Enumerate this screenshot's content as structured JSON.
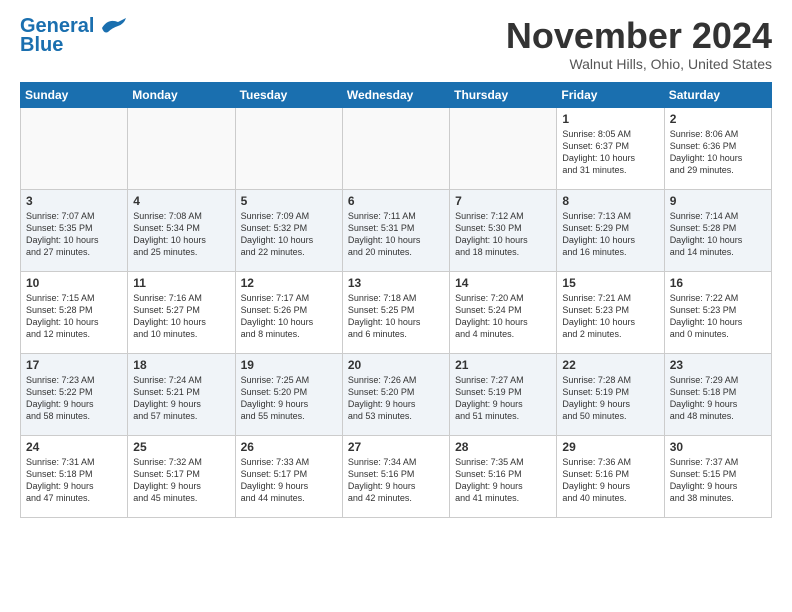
{
  "header": {
    "logo_line1": "General",
    "logo_line2": "Blue",
    "month": "November 2024",
    "location": "Walnut Hills, Ohio, United States"
  },
  "weekdays": [
    "Sunday",
    "Monday",
    "Tuesday",
    "Wednesday",
    "Thursday",
    "Friday",
    "Saturday"
  ],
  "weeks": [
    [
      {
        "day": "",
        "info": ""
      },
      {
        "day": "",
        "info": ""
      },
      {
        "day": "",
        "info": ""
      },
      {
        "day": "",
        "info": ""
      },
      {
        "day": "",
        "info": ""
      },
      {
        "day": "1",
        "info": "Sunrise: 8:05 AM\nSunset: 6:37 PM\nDaylight: 10 hours\nand 31 minutes."
      },
      {
        "day": "2",
        "info": "Sunrise: 8:06 AM\nSunset: 6:36 PM\nDaylight: 10 hours\nand 29 minutes."
      }
    ],
    [
      {
        "day": "3",
        "info": "Sunrise: 7:07 AM\nSunset: 5:35 PM\nDaylight: 10 hours\nand 27 minutes."
      },
      {
        "day": "4",
        "info": "Sunrise: 7:08 AM\nSunset: 5:34 PM\nDaylight: 10 hours\nand 25 minutes."
      },
      {
        "day": "5",
        "info": "Sunrise: 7:09 AM\nSunset: 5:32 PM\nDaylight: 10 hours\nand 22 minutes."
      },
      {
        "day": "6",
        "info": "Sunrise: 7:11 AM\nSunset: 5:31 PM\nDaylight: 10 hours\nand 20 minutes."
      },
      {
        "day": "7",
        "info": "Sunrise: 7:12 AM\nSunset: 5:30 PM\nDaylight: 10 hours\nand 18 minutes."
      },
      {
        "day": "8",
        "info": "Sunrise: 7:13 AM\nSunset: 5:29 PM\nDaylight: 10 hours\nand 16 minutes."
      },
      {
        "day": "9",
        "info": "Sunrise: 7:14 AM\nSunset: 5:28 PM\nDaylight: 10 hours\nand 14 minutes."
      }
    ],
    [
      {
        "day": "10",
        "info": "Sunrise: 7:15 AM\nSunset: 5:28 PM\nDaylight: 10 hours\nand 12 minutes."
      },
      {
        "day": "11",
        "info": "Sunrise: 7:16 AM\nSunset: 5:27 PM\nDaylight: 10 hours\nand 10 minutes."
      },
      {
        "day": "12",
        "info": "Sunrise: 7:17 AM\nSunset: 5:26 PM\nDaylight: 10 hours\nand 8 minutes."
      },
      {
        "day": "13",
        "info": "Sunrise: 7:18 AM\nSunset: 5:25 PM\nDaylight: 10 hours\nand 6 minutes."
      },
      {
        "day": "14",
        "info": "Sunrise: 7:20 AM\nSunset: 5:24 PM\nDaylight: 10 hours\nand 4 minutes."
      },
      {
        "day": "15",
        "info": "Sunrise: 7:21 AM\nSunset: 5:23 PM\nDaylight: 10 hours\nand 2 minutes."
      },
      {
        "day": "16",
        "info": "Sunrise: 7:22 AM\nSunset: 5:23 PM\nDaylight: 10 hours\nand 0 minutes."
      }
    ],
    [
      {
        "day": "17",
        "info": "Sunrise: 7:23 AM\nSunset: 5:22 PM\nDaylight: 9 hours\nand 58 minutes."
      },
      {
        "day": "18",
        "info": "Sunrise: 7:24 AM\nSunset: 5:21 PM\nDaylight: 9 hours\nand 57 minutes."
      },
      {
        "day": "19",
        "info": "Sunrise: 7:25 AM\nSunset: 5:20 PM\nDaylight: 9 hours\nand 55 minutes."
      },
      {
        "day": "20",
        "info": "Sunrise: 7:26 AM\nSunset: 5:20 PM\nDaylight: 9 hours\nand 53 minutes."
      },
      {
        "day": "21",
        "info": "Sunrise: 7:27 AM\nSunset: 5:19 PM\nDaylight: 9 hours\nand 51 minutes."
      },
      {
        "day": "22",
        "info": "Sunrise: 7:28 AM\nSunset: 5:19 PM\nDaylight: 9 hours\nand 50 minutes."
      },
      {
        "day": "23",
        "info": "Sunrise: 7:29 AM\nSunset: 5:18 PM\nDaylight: 9 hours\nand 48 minutes."
      }
    ],
    [
      {
        "day": "24",
        "info": "Sunrise: 7:31 AM\nSunset: 5:18 PM\nDaylight: 9 hours\nand 47 minutes."
      },
      {
        "day": "25",
        "info": "Sunrise: 7:32 AM\nSunset: 5:17 PM\nDaylight: 9 hours\nand 45 minutes."
      },
      {
        "day": "26",
        "info": "Sunrise: 7:33 AM\nSunset: 5:17 PM\nDaylight: 9 hours\nand 44 minutes."
      },
      {
        "day": "27",
        "info": "Sunrise: 7:34 AM\nSunset: 5:16 PM\nDaylight: 9 hours\nand 42 minutes."
      },
      {
        "day": "28",
        "info": "Sunrise: 7:35 AM\nSunset: 5:16 PM\nDaylight: 9 hours\nand 41 minutes."
      },
      {
        "day": "29",
        "info": "Sunrise: 7:36 AM\nSunset: 5:16 PM\nDaylight: 9 hours\nand 40 minutes."
      },
      {
        "day": "30",
        "info": "Sunrise: 7:37 AM\nSunset: 5:15 PM\nDaylight: 9 hours\nand 38 minutes."
      }
    ]
  ]
}
